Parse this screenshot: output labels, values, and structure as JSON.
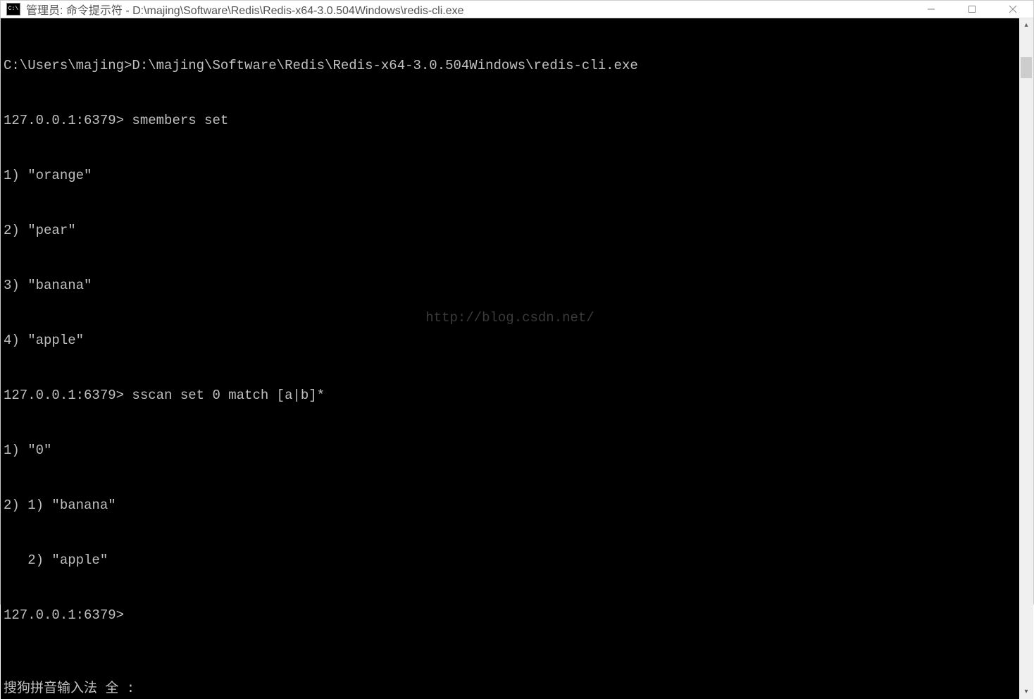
{
  "titlebar": {
    "icon_text": "C:\\",
    "title": "管理员: 命令提示符 - D:\\majing\\Software\\Redis\\Redis-x64-3.0.504Windows\\redis-cli.exe"
  },
  "terminal": {
    "lines": [
      "C:\\Users\\majing>D:\\majing\\Software\\Redis\\Redis-x64-3.0.504Windows\\redis-cli.exe",
      "127.0.0.1:6379> smembers set",
      "1) \"orange\"",
      "2) \"pear\"",
      "3) \"banana\"",
      "4) \"apple\"",
      "127.0.0.1:6379> sscan set 0 match [a|b]*",
      "1) \"0\"",
      "2) 1) \"banana\"",
      "   2) \"apple\"",
      "127.0.0.1:6379>"
    ],
    "watermark": "http://blog.csdn.net/",
    "ime_status": "搜狗拼音输入法 全 :"
  }
}
